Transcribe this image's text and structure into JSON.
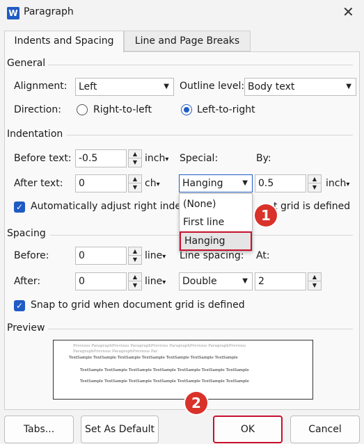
{
  "window": {
    "title": "Paragraph",
    "app_icon_letter": "W",
    "close_glyph": "✕"
  },
  "tabs": [
    {
      "label": "Indents and Spacing"
    },
    {
      "label": "Line and Page Breaks"
    }
  ],
  "general": {
    "section": "General",
    "alignment_label": "Alignment:",
    "alignment_value": "Left",
    "outline_label": "Outline level:",
    "outline_value": "Body text",
    "direction_label": "Direction:",
    "rtl_label": "Right-to-left",
    "ltr_label": "Left-to-right",
    "selected_direction": "Left-to-right"
  },
  "indentation": {
    "section": "Indentation",
    "before_label": "Before text:",
    "before_value": "-0.5",
    "before_unit": "inch",
    "after_label": "After text:",
    "after_value": "0",
    "after_unit": "ch",
    "special_label": "Special:",
    "special_value": "Hanging",
    "by_label": "By:",
    "by_value": "0.5",
    "by_unit": "inch",
    "auto_adjust_label_a": "Automatically adjust right inde",
    "auto_adjust_label_b": "t grid is defined",
    "auto_adjust_checked": true
  },
  "special_dropdown": {
    "options": [
      "(None)",
      "First line",
      "Hanging"
    ],
    "selected": "Hanging"
  },
  "spacing": {
    "section": "Spacing",
    "before_label": "Before:",
    "before_value": "0",
    "before_unit": "line",
    "after_label": "After:",
    "after_value": "0",
    "after_unit": "line",
    "line_spacing_label": "Line spacing:",
    "line_spacing_value": "Double",
    "at_label": "At:",
    "at_value": "2",
    "snap_label": "Snap to grid when document grid is defined",
    "snap_checked": true
  },
  "preview": {
    "section": "Preview",
    "prev_line1": "Previous ParagraphPrevious ParagraphPrevious ParagraphPrevious ParagraphPrevious",
    "prev_line2": "ParagraphPrevious ParagraphPrevious Par",
    "sample_line1": "TextSample TextSample TextSample TextSample TextSample TextSample TextSample",
    "sample_line2": "TextSample TextSample TextSample TextSample TextSample TextSample TextSample",
    "sample_line3": "TextSample TextSample TextSample TextSample TextSample TextSample TextSample"
  },
  "badges": {
    "one": "1",
    "two": "2",
    "color": "#d8322a"
  },
  "buttons": {
    "tabs": "Tabs...",
    "set_default": "Set As Default",
    "ok": "OK",
    "cancel": "Cancel"
  },
  "colors": {
    "accent": "#1f5bc4",
    "highlight_border": "#c8102e"
  }
}
